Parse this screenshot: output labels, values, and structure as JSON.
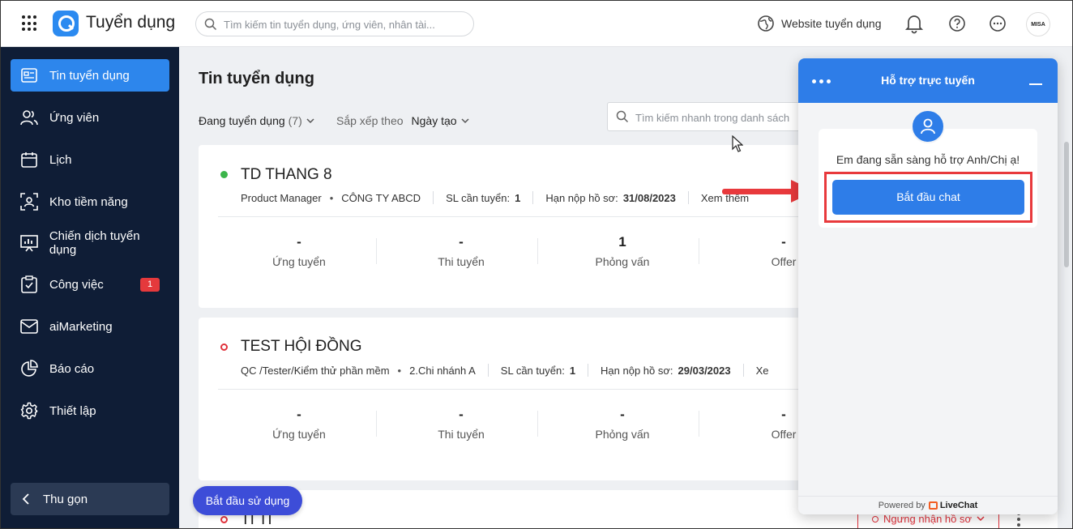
{
  "topbar": {
    "app_title": "Tuyển dụng",
    "search_placeholder": "Tìm kiếm tin tuyển dụng, ứng viên, nhân tài...",
    "website_label": "Website tuyển dụng",
    "avatar_text": "MISA"
  },
  "sidebar": {
    "items": [
      {
        "label": "Tin tuyển dụng",
        "icon": "job-post-icon",
        "active": true
      },
      {
        "label": "Ứng viên",
        "icon": "users-icon"
      },
      {
        "label": "Lịch",
        "icon": "calendar-icon"
      },
      {
        "label": "Kho tiềm năng",
        "icon": "talent-pool-icon"
      },
      {
        "label": "Chiến dịch tuyển dụng",
        "icon": "campaign-icon"
      },
      {
        "label": "Công việc",
        "icon": "task-icon",
        "badge": "1"
      },
      {
        "label": "aiMarketing",
        "icon": "mail-icon"
      },
      {
        "label": "Báo cáo",
        "icon": "pie-chart-icon"
      },
      {
        "label": "Thiết lập",
        "icon": "gear-icon"
      }
    ],
    "collapse_label": "Thu gọn"
  },
  "main": {
    "page_title": "Tin tuyển dụng",
    "filter_label": "Đang tuyển dụng",
    "filter_count": "(7)",
    "sort_label": "Sắp xếp theo",
    "sort_value": "Ngày tạo",
    "quick_search_placeholder": "Tìm kiếm nhanh trong danh sách",
    "jobs": [
      {
        "title": "TD THANG 8",
        "status": "green",
        "position": "Product Manager",
        "unit": "CÔNG TY ABCD",
        "quota_label": "SL cần tuyển:",
        "quota": "1",
        "deadline_label": "Hạn nộp hồ sơ:",
        "deadline": "31/08/2023",
        "more": "Xem thêm",
        "stages": [
          {
            "num": "-",
            "label": "Ứng tuyển"
          },
          {
            "num": "-",
            "label": "Thi tuyển"
          },
          {
            "num": "1",
            "label": "Phỏng vấn"
          },
          {
            "num": "-",
            "label": "Offer"
          }
        ]
      },
      {
        "title": "TEST HỘI ĐỒNG",
        "status": "red",
        "position": "QC /Tester/Kiểm thử phần mềm",
        "unit": "2.Chi nhánh A",
        "quota_label": "SL cần tuyển:",
        "quota": "1",
        "deadline_label": "Hạn nộp hồ sơ:",
        "deadline": "29/03/2023",
        "more": "Xe",
        "stages": [
          {
            "num": "-",
            "label": "Ứng tuyển"
          },
          {
            "num": "-",
            "label": "Thi tuyển"
          },
          {
            "num": "-",
            "label": "Phỏng vấn"
          },
          {
            "num": "-",
            "label": "Offer"
          }
        ]
      }
    ],
    "third_job_title_partial": "TI TI",
    "start_using_label": "Bắt đầu sử dụng",
    "stop_receiving_label": "Ngưng nhận hồ sơ"
  },
  "chat": {
    "title": "Hỗ trợ trực tuyến",
    "message": "Em đang sẵn sàng hỗ trợ Anh/Chị ạ!",
    "start_chat_label": "Bắt đầu chat",
    "powered_by": "Powered by",
    "brand": "LiveChat"
  },
  "colors": {
    "sidebar_bg": "#0f1d36",
    "accent": "#2d86ec",
    "annotation_red": "#e8393c",
    "status_green": "#3bb54a"
  }
}
